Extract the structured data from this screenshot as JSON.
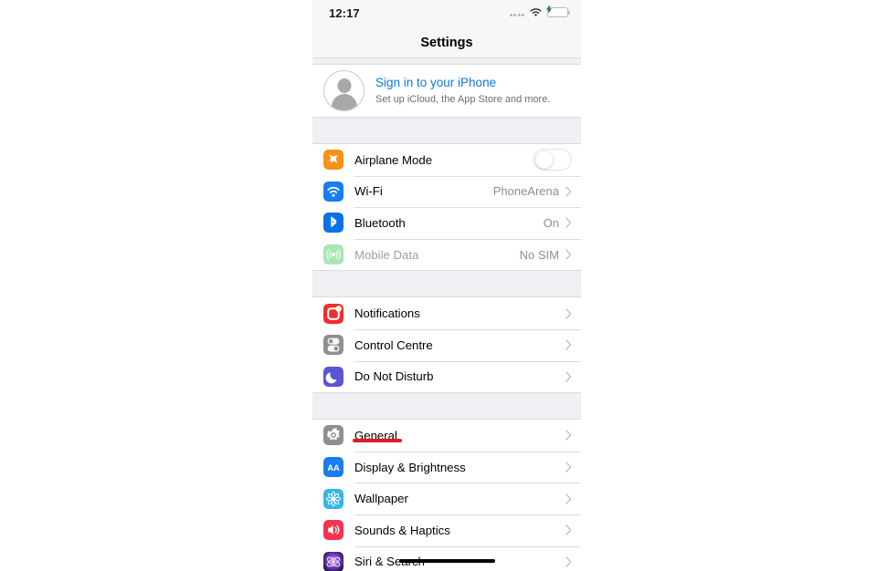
{
  "status_bar": {
    "time": "12:17",
    "signal_icon": "signal-dots-icon",
    "wifi_icon": "wifi-icon",
    "battery_icon": "battery-charging-icon"
  },
  "nav": {
    "title": "Settings"
  },
  "account": {
    "avatar_icon": "avatar-placeholder-icon",
    "title": "Sign in to your iPhone",
    "subtitle": "Set up iCloud, the App Store and more.",
    "title_color": "#0a7ae0"
  },
  "groups": [
    {
      "name": "connectivity",
      "rows": [
        {
          "id": "airplane-mode",
          "label": "Airplane Mode",
          "icon": "airplane-icon",
          "icon_color": "#f79219",
          "control": "toggle",
          "toggle_on": false,
          "value": "",
          "chevron": false,
          "dimmed": false
        },
        {
          "id": "wifi",
          "label": "Wi-Fi",
          "icon": "wifi-icon",
          "icon_color": "#1a7ced",
          "control": "value",
          "value": "PhoneArena",
          "chevron": true,
          "dimmed": false
        },
        {
          "id": "bluetooth",
          "label": "Bluetooth",
          "icon": "bluetooth-icon",
          "icon_color": "#0a72e8",
          "control": "value",
          "value": "On",
          "chevron": true,
          "dimmed": false
        },
        {
          "id": "mobile-data",
          "label": "Mobile Data",
          "icon": "cellular-icon",
          "icon_color": "#a9e6b4",
          "control": "value",
          "value": "No SIM",
          "chevron": true,
          "dimmed": true
        }
      ]
    },
    {
      "name": "alerts",
      "rows": [
        {
          "id": "notifications",
          "label": "Notifications",
          "icon": "notifications-icon",
          "icon_color": "#f32c2c",
          "control": "none",
          "value": "",
          "chevron": true,
          "dimmed": false
        },
        {
          "id": "control-centre",
          "label": "Control Centre",
          "icon": "control-centre-icon",
          "icon_color": "#8e8e93",
          "control": "none",
          "value": "",
          "chevron": true,
          "dimmed": false
        },
        {
          "id": "do-not-disturb",
          "label": "Do Not Disturb",
          "icon": "moon-icon",
          "icon_color": "#5a54d6",
          "control": "none",
          "value": "",
          "chevron": true,
          "dimmed": false
        }
      ]
    },
    {
      "name": "system",
      "rows": [
        {
          "id": "general",
          "label": "General",
          "icon": "gear-icon",
          "icon_color": "#8e8e93",
          "control": "none",
          "value": "",
          "chevron": true,
          "dimmed": false
        },
        {
          "id": "display-brightness",
          "label": "Display & Brightness",
          "icon": "display-brightness-icon",
          "icon_color": "#1a7ced",
          "control": "none",
          "value": "",
          "chevron": true,
          "dimmed": false
        },
        {
          "id": "wallpaper",
          "label": "Wallpaper",
          "icon": "wallpaper-icon",
          "icon_color": "#34b6e8",
          "control": "none",
          "value": "",
          "chevron": true,
          "dimmed": false
        },
        {
          "id": "sounds-haptics",
          "label": "Sounds & Haptics",
          "icon": "speaker-icon",
          "icon_color": "#f4334f",
          "control": "none",
          "value": "",
          "chevron": true,
          "dimmed": false
        },
        {
          "id": "siri-search",
          "label": "Siri & Search",
          "icon": "siri-icon",
          "icon_color": "#151335",
          "control": "none",
          "value": "",
          "chevron": true,
          "dimmed": false
        }
      ]
    }
  ],
  "annotations": {
    "general_underline_color": "#e01b22",
    "home_indicator_color": "#000000"
  }
}
